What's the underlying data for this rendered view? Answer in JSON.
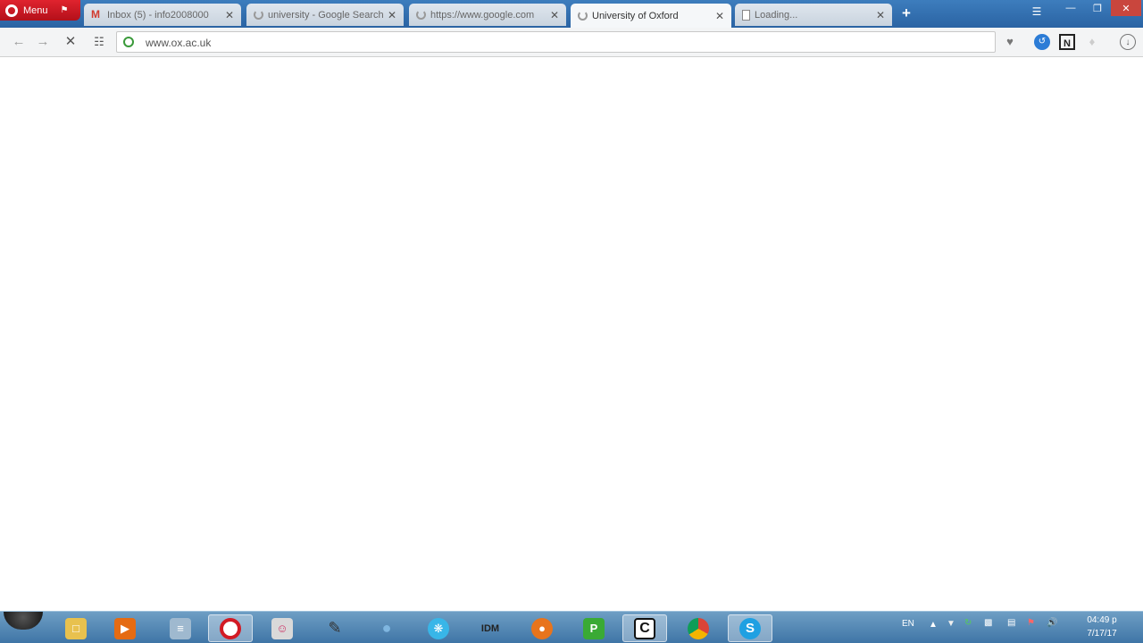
{
  "browser": {
    "menu_label": "Menu",
    "tabs": [
      {
        "label": "Inbox (5) - info2008000",
        "icon": "gmail-icon",
        "active": false
      },
      {
        "label": "university - Google Search",
        "icon": "loading-spinner-icon",
        "active": false
      },
      {
        "label": "https://www.google.com",
        "icon": "loading-spinner-icon",
        "active": false
      },
      {
        "label": "University of Oxford",
        "icon": "loading-spinner-icon",
        "active": true
      },
      {
        "label": "Loading...",
        "icon": "page-icon",
        "active": false
      }
    ],
    "new_tab_label": "+",
    "address": {
      "url": "www.ox.ac.uk"
    }
  },
  "taskbar": {
    "apps": [
      "file-explorer-icon",
      "media-player-icon",
      "notepad-icon",
      "opera-icon",
      "presenter-icon",
      "tool-icon",
      "maps-icon",
      "network-icon",
      "idm-icon",
      "firefox-icon",
      "p-app-icon",
      "c-app-icon",
      "chrome-icon",
      "skype-icon"
    ],
    "language": "EN",
    "clock_time": "04:49 p",
    "clock_date": "7/17/17"
  }
}
